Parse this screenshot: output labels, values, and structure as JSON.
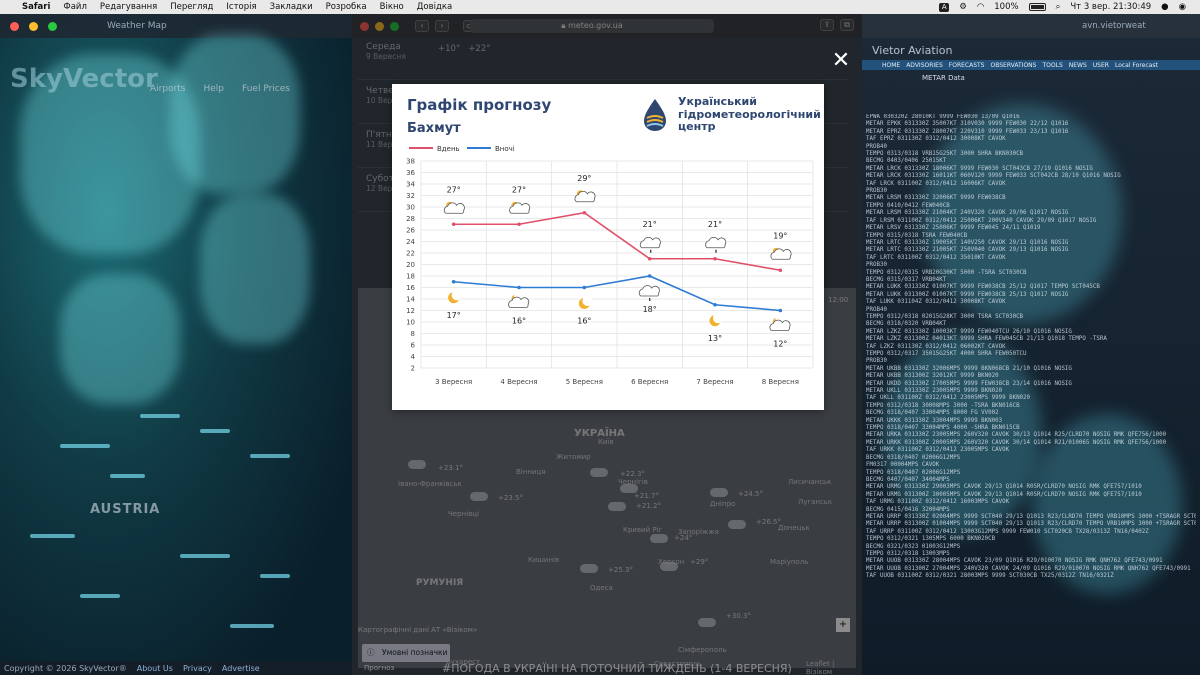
{
  "menubar": {
    "apple": "",
    "app": "Safari",
    "items": [
      "Файл",
      "Редагування",
      "Перегляд",
      "Історія",
      "Закладки",
      "Розробка",
      "Вікно",
      "Довідка"
    ],
    "keyboard": "A",
    "battery": "100%",
    "datetime": "Чт 3 вер.  21:30:49"
  },
  "left_window": {
    "logo": "SkyVector",
    "tab_title": "Weather Map",
    "nav": [
      "Airports",
      "Help",
      "Fuel Prices"
    ],
    "region_label": "AUSTRIA",
    "footer": {
      "copyright": "Copyright © 2026 SkyVector®",
      "links": [
        "About Us",
        "Privacy",
        "Advertise"
      ]
    }
  },
  "right_window": {
    "url": "avn.vietorweat",
    "brand": "Vietor Aviation",
    "nav": [
      "HOME",
      "ADVISORIES",
      "FORECASTS",
      "OBSERVATIONS",
      "TOOLS",
      "NEWS",
      "USER",
      "Local Forecast"
    ],
    "panel_title": "METAR Data",
    "metar_lines": [
      "EPWA 030320Z 28010KT 9999 FEW030 13/09 Q1016",
      "METAR EPKK 031330Z 35007KT 310V030 9999 FEW030 22/12 Q1016",
      "METAR EPRZ 031330Z 28007KT 220V310 9999 FEW033 23/13 Q1016",
      "TAF EPRZ 031130Z 0312/0412 30008KT CAVOK",
      "   PROB40",
      "   TEMPO 0313/0318 VRB15G25KT 3000 SHRA BKN030CB",
      "   BECMG 0403/0406 25015KT",
      "METAR LRCK 031330Z 18006KT 9999 FEW030 SCT043CB 27/19 Q1016 NOSIG",
      "METAR LRCK 031330Z 16011KT 060V120 9999 FEW033 SCT042CB 28/10 Q1016 NOSIG",
      "TAF LRCK 031100Z 0312/0412 16006KT CAVOK",
      "   PROB30",
      "METAR LRSM 031330Z 32006KT 9999 FEW038CB",
      "   TEMPO 0410/0412 FEW040CB",
      "METAR LRSM 031330Z 21004KT 240V320 CAVOK 29/06 Q1017 NOSIG",
      "TAF LRSM 031100Z 0312/0412 25006KT 200V340 CAVOK 29/09 Q1017 NOSIG",
      "METAR LRSV 031330Z 25006KT 9999 FEW045 24/11 Q1019",
      "   TEMPO 0315/0318 TSRA FEW040CB",
      "METAR LRTC 031330Z 19005KT 140V250 CAVOK 29/13 Q1016 NOSIG",
      "METAR LRTC 031330Z 21005KT 250V040 CAVOK 29/13 Q1016 NOSIG",
      "TAF LRTC 031100Z 0312/0412 35010KT CAVOK",
      "   PROB30",
      "   TEMPO 0312/0315 VRB20G30KT 5000 -TSRA SCT030CB",
      "   BECMG 0315/0317 VRB04KT",
      "METAR LUKK 031330Z 01007KT 9999 FEW038CB 25/12 Q1017 TEMPO SCT045CB",
      "METAR LUKK 031300Z 01007KT 9999 FEW038CB 25/13 Q1017 NOSIG",
      "TAF LUKK 031104Z 0312/0412 30008KT CAVOK",
      "   PROB40",
      "   TEMPO 0312/0318 02015G28KT 3000 TSRA SCT030CB",
      "   BECMG 0318/0320 VRB04KT",
      "METAR LZKZ 031330Z 10003KT 9999 FEW040TCU 26/10 Q1016 NOSIG",
      "METAR LZKZ 031300Z 04013KT 9999 SHRA FEW045CB 21/13 Q1018 TEMPO -TSRA",
      "TAF LZKZ 031130Z 0312/0412 06002KT CAVOK",
      "   TEMPO 0312/0317 35015G25KT 4000 SHRA FEW050TCU",
      "   PROB30",
      "METAR UKBB 031330Z 32006MPS 9999 BKN068CB 21/10 Q1016 NOSIG",
      "METAR UKBB 031300Z 32012KT 9999 BKN020",
      "METAR UKDD 031330Z 27005MPS 9999 FEW038CB 23/14 Q1016 NOSIG",
      "METAR UKLL 031330Z 23005MPS 9999 BKN020",
      "TAF UKLL 031100Z 0312/0412 23005MPS 9999 BKN020",
      "   TEMPO 0312/0318 30008MPS 3000 -TSRA BKN016CB",
      "   BECMG 0318/0407 33004MPS 8000 FG VV002",
      "METAR UKKK 031330Z 33004MPS 9999 BKN003",
      "   TEMPO 0318/0407 33004MPS 4000 -SHRA BKN015CB",
      "METAR URKA 031330Z 23005MPS 260V320 CAVOK 30/13 Q1014 R25/CLRD70 NOSIG RMK QFE756/1000",
      "METAR URKK 031300Z 20005MPS 260V320 CAVOK 30/14 Q1014 R21/010065 NOSIG RMK QFE756/1000",
      "TAF URKK 031100Z 0312/0412 23005MPS CAVOK",
      "   BECMG 0318/0407 02006G12MPS",
      "   FM0317 00004MPS CAVOK",
      "   TEMPO 0318/0407 02006G12MPS",
      "   BECMG 0407/0407 34004MPS",
      "METAR URMG 031330Z 29003MPS CAVOK 29/13 Q1014 R05R/CLRD70 NOSIG RMK QFE757/1010",
      "METAR URMG 031300Z 30005MPS CAVOK 29/13 Q1014 R05R/CLRD70 NOSIG RMK QFE757/1010",
      "TAF URMG 031100Z 0312/0412 16003MPS CAVOK",
      "   BECMG 0415/0416 32004MPS",
      "METAR URRP 031330Z 02004MPS 9999 SCT040 29/13 Q1013 R23/CLRD70 TEMPO VRB10MPS 3000 +TSRAGR SCT005CB",
      "METAR URRP 031300Z 01004MPS 9999 SCT040 29/13 Q1013 R23/CLRD70 TEMPO VRB10MPS 3000 +TSRAGR SCT005CB",
      "TAF URRP 031100Z 0312/0412 13003G12MPS 9999 FEW010 SCT020CB TX28/0313Z TN16/0402Z",
      "   TEMPO 0312/0321 1305MPS 6000 BKN020CB",
      "   BECMG 0321/0323 01003G12MPS",
      "   TEMPO 0312/0318 13003MPS",
      "METAR UUOB 031330Z 28004MPS CAVOK 23/09 Q1016 R29/010070 NOSIG RMK QNH762 QFE743/0991",
      "METAR UUOB 031300Z 27004MPS 240V320 CAVOK 24/09 Q1016 R29/010070 NOSIG RMK QNH762 QFE743/0991",
      "TAF UUOB 031100Z 0312/0321 28003MPS 9999 SCT030CB TX25/0312Z TN16/0321Z"
    ]
  },
  "safari": {
    "url": "meteo.gov.ua"
  },
  "page": {
    "days": [
      {
        "name": "Середа",
        "date": "9 Вересня",
        "t1": "+10°",
        "t2": "+22°"
      },
      {
        "name": "Четвер",
        "date": "10 Вересня",
        "t1": "",
        "t2": ""
      },
      {
        "name": "П'ятниця",
        "date": "11 Вересня",
        "t1": "",
        "t2": ""
      },
      {
        "name": "Субота",
        "date": "12 Вересня",
        "t1": "",
        "t2": ""
      }
    ],
    "map_country": "УКРАЇНА",
    "map_neighbor": "РУМУНІЯ",
    "map_cities": [
      "Вінниця",
      "Київ",
      "Чернігів",
      "Житомир",
      "Чернівці",
      "Кривий Ріг",
      "Запоріжжя",
      "Дніпро",
      "Луганськ",
      "Донецьк",
      "Маріуполь",
      "Одеса",
      "Херсон",
      "Сімферополь",
      "Севастополь",
      "Лисичанськ",
      "Бухарест",
      "Кишинів",
      "Івано-Франківськ"
    ],
    "map_temps": [
      "+23.1°",
      "+23.5°",
      "+22.3°",
      "+21.2°",
      "+24.5°",
      "+26.5°",
      "+25.3°",
      "+29°",
      "+30.3°",
      "+24°",
      "+21.7°"
    ],
    "time_label": "12:00",
    "legend_button": "Умовні позначки",
    "map_credit": "Картографічні дані АТ «Візіком»",
    "map_source": "Leaflet | Візіком",
    "news_title": "#ПОГОДА В УКРАЇНІ НА ПОТОЧНИЙ ТИЖДЕНЬ (1-4 ВЕРЕСНЯ)",
    "news_tag": "Прогноз"
  },
  "modal": {
    "title": "Графік прогнозу",
    "city": "Бахмут",
    "org_name": [
      "Український",
      "гідрометеорологічний",
      "центр"
    ]
  },
  "chart_data": {
    "type": "line",
    "title": "Графік прогнозу",
    "categories": [
      "3 Вересня",
      "4 Вересня",
      "5 Вересня",
      "6 Вересня",
      "7 Вересня",
      "8 Вересня"
    ],
    "series": [
      {
        "name": "Вдень",
        "color": "#e0506a",
        "values": [
          27,
          27,
          29,
          21,
          21,
          19
        ],
        "icons": [
          "partly-cloudy",
          "partly-cloudy",
          "partly-cloudy",
          "cloud-rain",
          "cloud-rain",
          "partly-cloudy"
        ]
      },
      {
        "name": "Вночі",
        "color": "#2f7bd4",
        "values": [
          17,
          16,
          16,
          18,
          13,
          12
        ],
        "icons": [
          "moon",
          "moon-cloud",
          "moon",
          "cloud-rain",
          "moon",
          "moon-cloud"
        ]
      }
    ],
    "yticks": [
      2,
      4,
      6,
      8,
      10,
      12,
      14,
      16,
      18,
      20,
      22,
      24,
      26,
      28,
      30,
      32,
      34,
      36,
      38
    ],
    "ylim": [
      2,
      38
    ],
    "grid": true,
    "legend": "top-left"
  }
}
